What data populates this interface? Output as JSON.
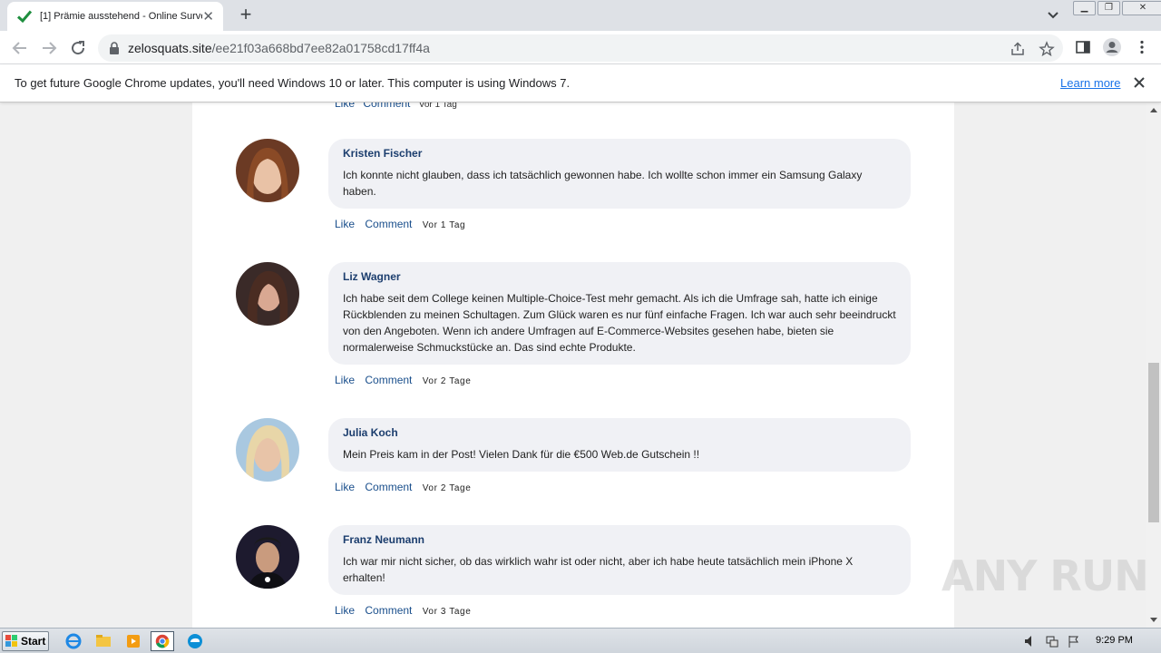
{
  "browser": {
    "tab_title": "[1] Prämie ausstehend - Online Survey",
    "url_host": "zelosquats.site",
    "url_path": "/ee21f03a668bd7ee82a01758cd17ff4a"
  },
  "infobar": {
    "message": "To get future Google Chrome updates, you'll need Windows 10 or later. This computer is using Windows 7.",
    "link": "Learn more"
  },
  "page": {
    "partial_top": {
      "like": "Like",
      "comment": "Comment",
      "time": "Vor 1 Tag"
    },
    "comments": [
      {
        "name": "Kristen Fischer",
        "text": "Ich konnte nicht glauben, dass ich tatsächlich gewonnen habe. Ich wollte schon immer ein Samsung Galaxy haben.",
        "like": "Like",
        "comment": "Comment",
        "time": "Vor 1 Tag"
      },
      {
        "name": "Liz Wagner",
        "text": "Ich habe seit dem College keinen Multiple-Choice-Test mehr gemacht. Als ich die Umfrage sah, hatte ich einige Rückblenden zu meinen Schultagen. Zum Glück waren es nur fünf einfache Fragen. Ich war auch sehr beeindruckt von den Angeboten. Wenn ich andere Umfragen auf E-Commerce-Websites gesehen habe, bieten sie normalerweise Schmuckstücke an. Das sind echte Produkte.",
        "like": "Like",
        "comment": "Comment",
        "time": "Vor 2 Tage"
      },
      {
        "name": "Julia Koch",
        "text": "Mein Preis kam in der Post! Vielen Dank für die €500 Web.de Gutschein !!",
        "like": "Like",
        "comment": "Comment",
        "time": "Vor 2 Tage"
      },
      {
        "name": "Franz Neumann",
        "text": "Ich war mir nicht sicher, ob das wirklich wahr ist oder nicht, aber ich habe heute tatsächlich mein iPhone X erhalten!",
        "like": "Like",
        "comment": "Comment",
        "time": "Vor 3 Tage"
      }
    ]
  },
  "watermark": "ANY RUN",
  "taskbar": {
    "start": "Start",
    "clock": "9:29 PM"
  }
}
